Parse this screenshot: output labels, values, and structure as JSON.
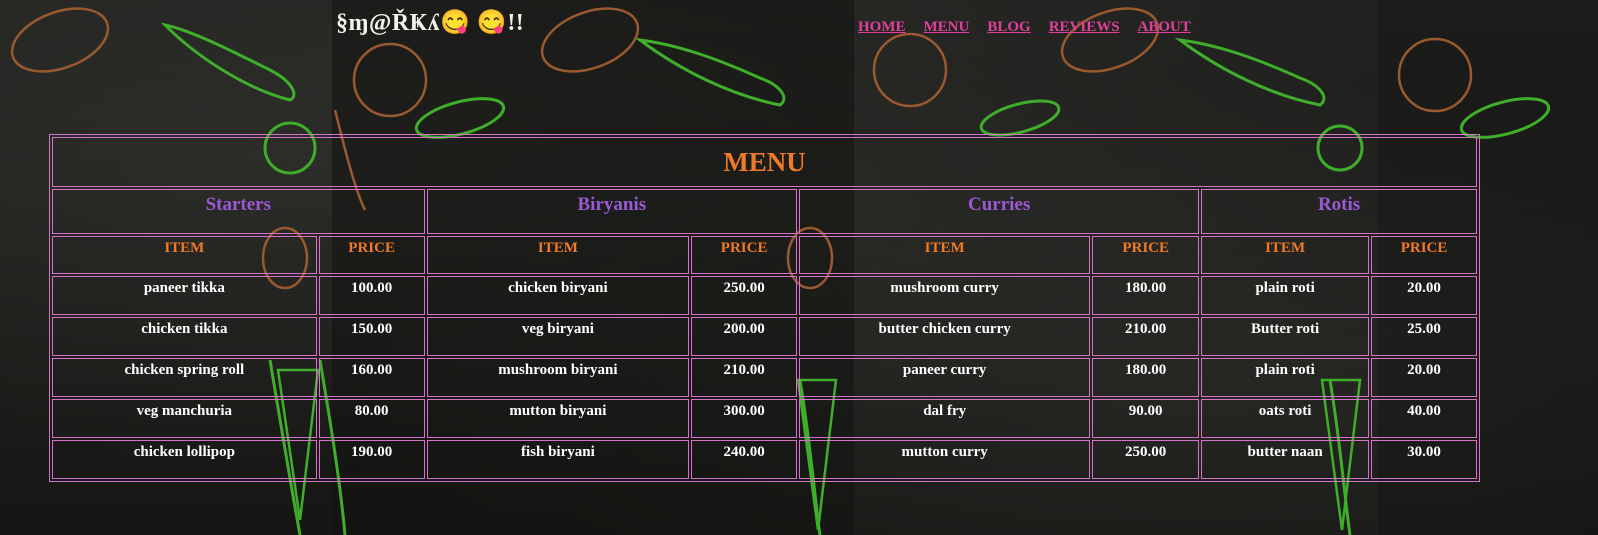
{
  "brand": "§ɱ@ŘҜʎ😋 😋!!",
  "nav": {
    "items": [
      "HOME",
      "MENU",
      "BLOG",
      "REVIEWS",
      "ABOUT"
    ]
  },
  "menu": {
    "title": "MENU",
    "item_header": "ITEM",
    "price_header": "PRICE",
    "sections": [
      {
        "name": "Starters",
        "rows": [
          {
            "item": "paneer tikka",
            "price": "100.00"
          },
          {
            "item": "chicken tikka",
            "price": "150.00"
          },
          {
            "item": "chicken spring roll",
            "price": "160.00"
          },
          {
            "item": "veg manchuria",
            "price": "80.00"
          },
          {
            "item": "chicken lollipop",
            "price": "190.00"
          }
        ]
      },
      {
        "name": "Biryanis",
        "rows": [
          {
            "item": "chicken biryani",
            "price": "250.00"
          },
          {
            "item": "veg biryani",
            "price": "200.00"
          },
          {
            "item": "mushroom biryani",
            "price": "210.00"
          },
          {
            "item": "mutton biryani",
            "price": "300.00"
          },
          {
            "item": "fish biryani",
            "price": "240.00"
          }
        ]
      },
      {
        "name": "Curries",
        "rows": [
          {
            "item": "mushroom curry",
            "price": "180.00"
          },
          {
            "item": "butter chicken curry",
            "price": "210.00"
          },
          {
            "item": "paneer curry",
            "price": "180.00"
          },
          {
            "item": "dal fry",
            "price": "90.00"
          },
          {
            "item": "mutton curry",
            "price": "250.00"
          }
        ]
      },
      {
        "name": "Rotis",
        "rows": [
          {
            "item": "plain roti",
            "price": "20.00"
          },
          {
            "item": "Butter roti",
            "price": "25.00"
          },
          {
            "item": "plain roti",
            "price": "20.00"
          },
          {
            "item": "oats roti",
            "price": "40.00"
          },
          {
            "item": "butter naan",
            "price": "30.00"
          }
        ]
      }
    ]
  },
  "colors": {
    "nav_link": "#e0409c",
    "title": "#f07a25",
    "section": "#9b59d6",
    "border": "#d772c9",
    "cell_text": "#ffffff"
  }
}
